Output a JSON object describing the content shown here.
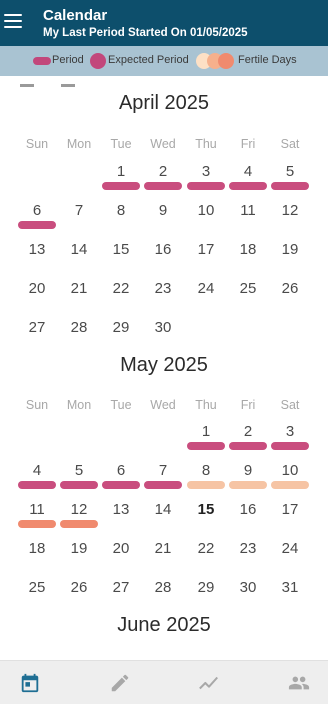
{
  "header": {
    "title": "Calendar",
    "subtitle": "My Last Period Started On 01/05/2025"
  },
  "legend": {
    "period_label": "Period",
    "expected_label": "Expected Period",
    "fertile_label": "Fertile Days"
  },
  "colors": {
    "appbar": "#0d4f6c",
    "legend_bg": "#a9c3d2",
    "period": "#c94d7e",
    "expected": "#c2477b",
    "fertile": "#f6c4a4",
    "ovulation": "#f08a6e",
    "nav_active": "#1e6e93",
    "nav_inactive": "#a8a8a8"
  },
  "weekdays": [
    "Sun",
    "Mon",
    "Tue",
    "Wed",
    "Thu",
    "Fri",
    "Sat"
  ],
  "months": [
    {
      "title": "April 2025",
      "first_weekday": 2,
      "days_in_month": 30,
      "period_days": [
        1,
        2,
        3,
        4,
        5,
        6
      ],
      "fertile_days": [],
      "ovulation_days": [],
      "today": null
    },
    {
      "title": "May 2025",
      "first_weekday": 4,
      "days_in_month": 31,
      "period_days": [
        1,
        2,
        3,
        4,
        5,
        6,
        7
      ],
      "fertile_days": [
        8,
        9,
        10
      ],
      "ovulation_days": [
        11,
        12
      ],
      "today": 15
    },
    {
      "title": "June 2025"
    }
  ],
  "nav": {
    "items": [
      {
        "name": "calendar",
        "icon": "calendar-icon",
        "active": true
      },
      {
        "name": "edit",
        "icon": "pencil-icon",
        "active": false
      },
      {
        "name": "trends",
        "icon": "chart-line-icon",
        "active": false
      },
      {
        "name": "community",
        "icon": "people-icon",
        "active": false
      }
    ]
  }
}
